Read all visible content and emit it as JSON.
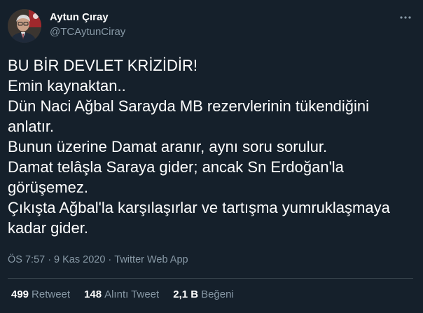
{
  "author": {
    "name": "Aytun Çıray",
    "handle": "@TCAytunCiray",
    "avatar_icon": "profile-photo"
  },
  "more_icon": "more-horizontal-icon",
  "tweet": {
    "lines": [
      "BU BİR DEVLET KRİZİDİR!",
      "Emin kaynaktan..",
      "Dün Naci Ağbal Sarayda MB rezervlerinin tükendiğini",
      "anlatır.",
      "Bunun üzerine Damat aranır, aynı soru sorulur.",
      "Damat telâşla Saraya gider; ancak Sn Erdoğan'la",
      "görüşemez.",
      "Çıkışta Ağbal'la karşılaşırlar ve tartışma yumruklaşmaya",
      "kadar gider."
    ]
  },
  "meta": {
    "time": "ÖS 7:57",
    "separator": "·",
    "date": "9 Kas 2020",
    "source": "Twitter Web App"
  },
  "stats": {
    "retweets": {
      "value": "499",
      "label": "Retweet"
    },
    "quotes": {
      "value": "148",
      "label": "Alıntı Tweet"
    },
    "likes": {
      "value": "2,1 B",
      "label": "Beğeni"
    }
  },
  "colors": {
    "background": "#15202b",
    "text": "#ffffff",
    "secondary": "#8899a6",
    "divider": "#38444d"
  }
}
